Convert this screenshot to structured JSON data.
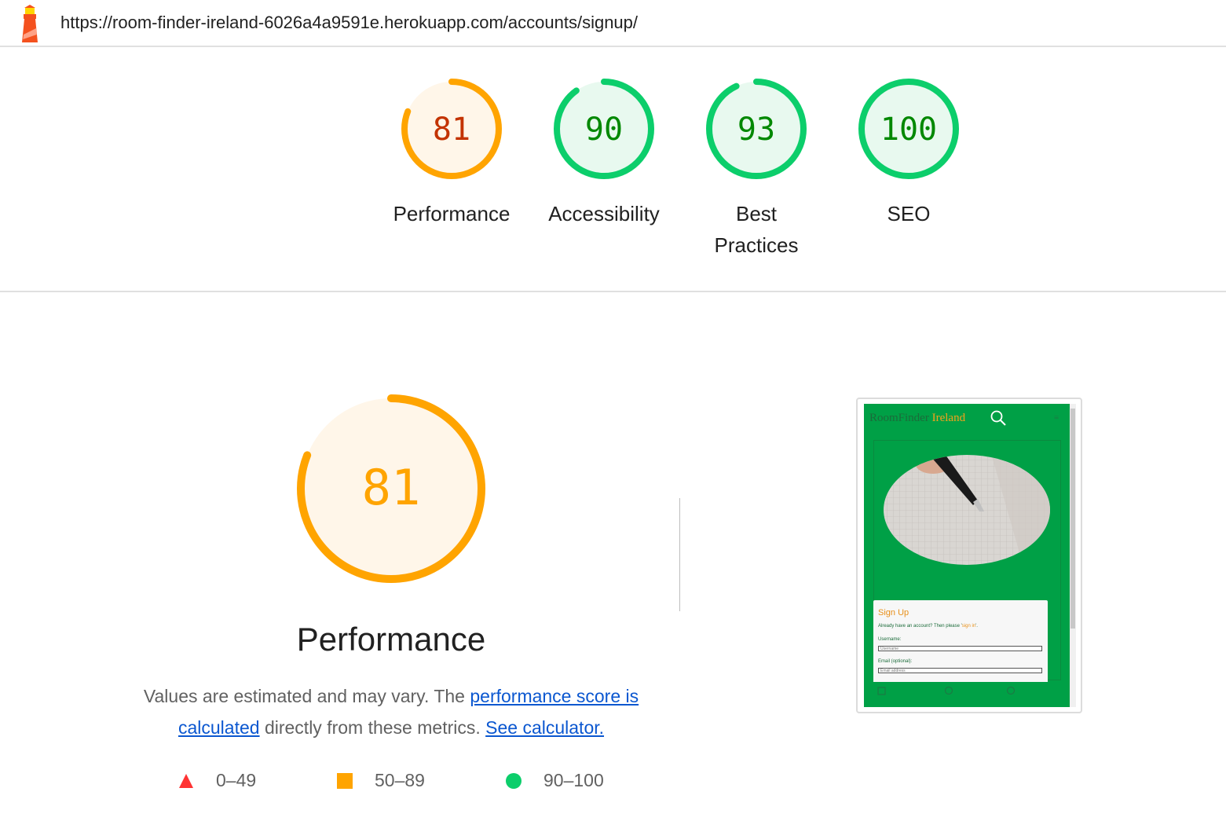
{
  "url": "https://room-finder-ireland-6026a4a9591e.herokuapp.com/accounts/signup/",
  "icons": {
    "logo": "lighthouse-icon",
    "search": "search-magnifier-icon",
    "menu": "hamburger-icon"
  },
  "colors": {
    "average": "#ffa400",
    "pass": "#0cce6b",
    "fail": "#ff4e42",
    "average_text": "#c33300",
    "pass_text": "#008800"
  },
  "scores": [
    {
      "value": "81",
      "label": "Performance",
      "status": "average"
    },
    {
      "value": "90",
      "label": "Accessibility",
      "status": "pass"
    },
    {
      "value": "93",
      "label": "Best Practices",
      "status": "pass"
    },
    {
      "value": "100",
      "label": "SEO",
      "status": "pass"
    }
  ],
  "main": {
    "score": "81",
    "title": "Performance",
    "desc_pre": "Values are estimated and may vary. The ",
    "desc_link1": "performance score is calculated",
    "desc_mid": " directly from these metrics. ",
    "desc_link2": "See calculator."
  },
  "legend": [
    {
      "range": "0–49",
      "shape": "triangle"
    },
    {
      "range": "50–89",
      "shape": "square"
    },
    {
      "range": "90–100",
      "shape": "circle"
    }
  ],
  "thumbnail": {
    "brand": "RoomFinder",
    "brand_accent": "Ireland",
    "menu_glyph": "≡",
    "form_title": "Sign Up",
    "form_sub_pre": "Already have an account? Then please ",
    "form_sub_link": "sign in",
    "form_sub_post": ".",
    "username_label": "Username:",
    "username_placeholder": "Username",
    "email_label": "Email (optional):",
    "email_placeholder": "Email address"
  }
}
